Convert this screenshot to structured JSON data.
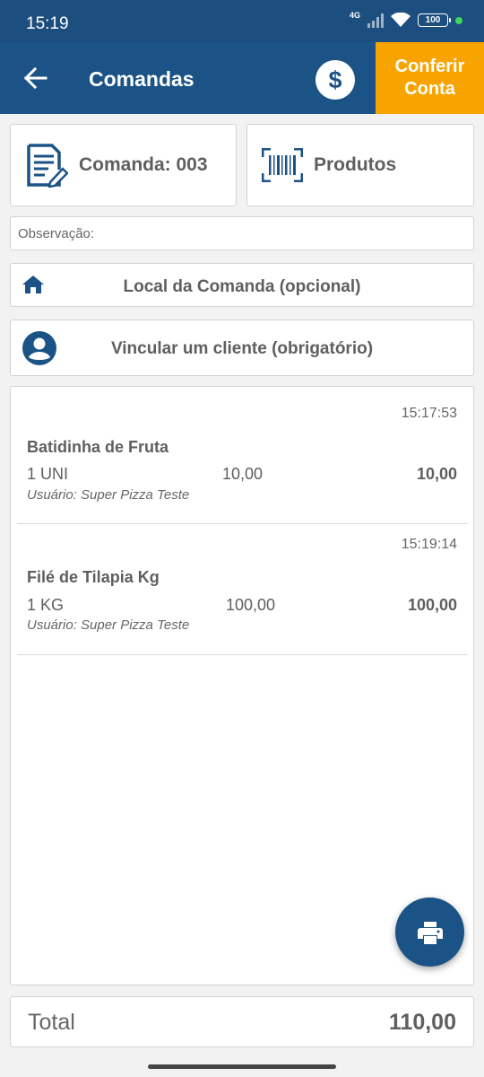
{
  "status_bar": {
    "time": "15:19",
    "network": "4G",
    "battery": "100",
    "icons": [
      "signal-icon",
      "wifi-icon",
      "battery-icon"
    ]
  },
  "app_bar": {
    "title": "Comandas",
    "back_icon": "arrow-left-icon",
    "money_symbol": "$",
    "conferir_label": "Conferir\nConta",
    "colors": {
      "primary": "#1c5386",
      "accent": "#f8a400"
    }
  },
  "actions": {
    "comanda_label": "Comanda: 003",
    "produtos_label": "Produtos"
  },
  "observacao": {
    "placeholder": "Observação:"
  },
  "local": {
    "label": "Local da Comanda (opcional)"
  },
  "cliente": {
    "label": "Vincular um cliente (obrigatório)"
  },
  "items": [
    {
      "time": "15:17:53",
      "name": "Batidinha de Fruta",
      "qty": "1 UNI",
      "unit_price": "10,00",
      "total": "10,00",
      "user": "Usuário: Super Pizza Teste"
    },
    {
      "time": "15:19:14",
      "name": "Filé de Tilapia Kg",
      "qty": "1 KG",
      "unit_price": "100,00",
      "total": "100,00",
      "user": "Usuário: Super Pizza Teste"
    }
  ],
  "summary": {
    "total_label": "Total",
    "total_value": "110,00"
  }
}
